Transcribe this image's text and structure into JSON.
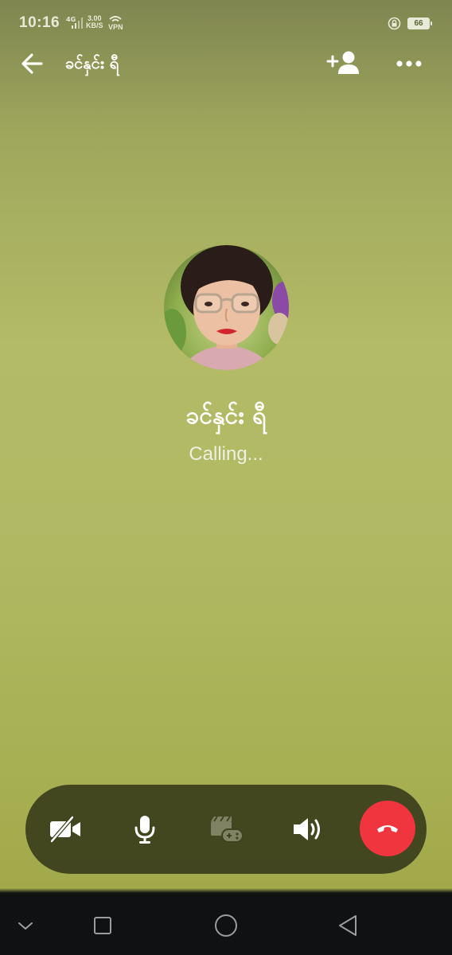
{
  "status_bar": {
    "time": "10:16",
    "network": "4G",
    "speed_value": "3.00",
    "speed_unit": "KB/S",
    "vpn": "VPN",
    "battery": "66"
  },
  "header": {
    "title": "ခင်နှင်း ရီ",
    "back_icon": "arrow-left-icon",
    "add_person_icon": "add-person-icon",
    "more_icon": "more-horizontal-icon"
  },
  "call": {
    "caller_name": "ခင်နှင်း ရီ",
    "status": "Calling..."
  },
  "controls": {
    "items": [
      {
        "name": "video-off",
        "icon": "video-off-icon"
      },
      {
        "name": "microphone",
        "icon": "microphone-icon"
      },
      {
        "name": "games",
        "icon": "games-icon",
        "disabled": true
      },
      {
        "name": "speaker",
        "icon": "speaker-icon"
      },
      {
        "name": "end-call",
        "icon": "end-call-icon",
        "color": "#f0353e"
      }
    ]
  },
  "system_nav": {
    "items": [
      "collapse-icon",
      "recents-icon",
      "home-icon",
      "back-icon"
    ]
  }
}
